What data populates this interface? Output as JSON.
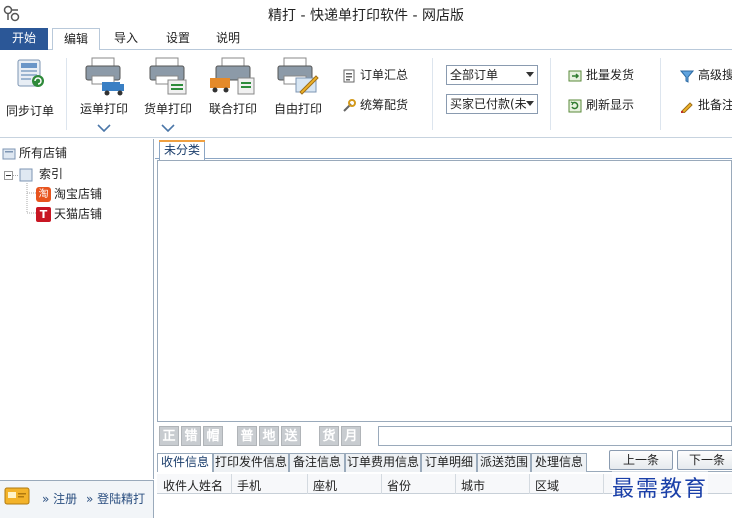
{
  "window": {
    "title": "精打 - 快递单打印软件 - 网店版"
  },
  "menu_tabs": {
    "start": "开始",
    "edit": "编辑",
    "import": "导入",
    "settings": "设置",
    "help": "说明"
  },
  "ribbon": {
    "sync_orders": "同步订单",
    "waybill_print": "运单打印",
    "goods_print": "货单打印",
    "combined_print": "联合打印",
    "free_print": "自由打印",
    "order_summary": "订单汇总",
    "plan_distribution": "统筹配货",
    "order_filter": "全部订单",
    "payment_filter": "买家已付款(未",
    "batch_ship": "批量发货",
    "refresh": "刷新显示",
    "advanced_search": "高级搜",
    "batch_note": "批备注"
  },
  "tree": {
    "root": "所有店铺",
    "index": "索引",
    "taobao": "淘宝店铺",
    "taobao_badge": "淘",
    "tmall": "天猫店铺",
    "tmall_badge": "T"
  },
  "footer": {
    "register": "注册",
    "login": "登陆精打",
    "link_prefix": "»"
  },
  "main": {
    "category_tab": "未分类"
  },
  "toolbar_buttons": [
    "正",
    "错",
    "帽",
    "普",
    "地",
    "送",
    "货",
    "月"
  ],
  "detail_tabs": [
    "收件信息",
    "打印发件信息",
    "备注信息",
    "订单费用信息",
    "订单明细",
    "派送范围",
    "处理信息"
  ],
  "nav": {
    "prev": "上一条",
    "next": "下一条"
  },
  "table_columns": [
    "收件人姓名",
    "手机",
    "座机",
    "省份",
    "城市",
    "区域"
  ],
  "watermark": "最需教育",
  "colors": {
    "start_tab": "#2b5797",
    "active_tab_accent": "#f0a040",
    "watermark": "#1a3fa8"
  }
}
